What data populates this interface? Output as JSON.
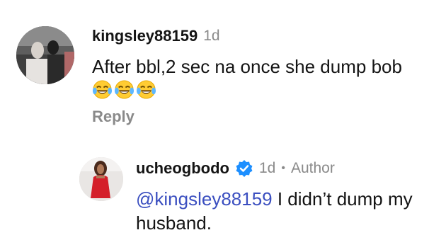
{
  "comments": [
    {
      "username": "kingsley88159",
      "time": "1d",
      "text": "After bbl,2 sec na once she dump bob",
      "emojis": [
        "face-with-tears-of-joy",
        "face-with-tears-of-joy",
        "face-with-tears-of-joy"
      ],
      "reply_label": "Reply"
    },
    {
      "username": "ucheogbodo",
      "verified": true,
      "time": "1d",
      "separator": "•",
      "badge": "Author",
      "mention": "@kingsley88159",
      "text": " I didn’t dump my husband."
    }
  ],
  "colors": {
    "mention": "#3b4fc0",
    "verified": "#1d8fff",
    "muted": "#8a8a8a",
    "text": "#141414"
  }
}
